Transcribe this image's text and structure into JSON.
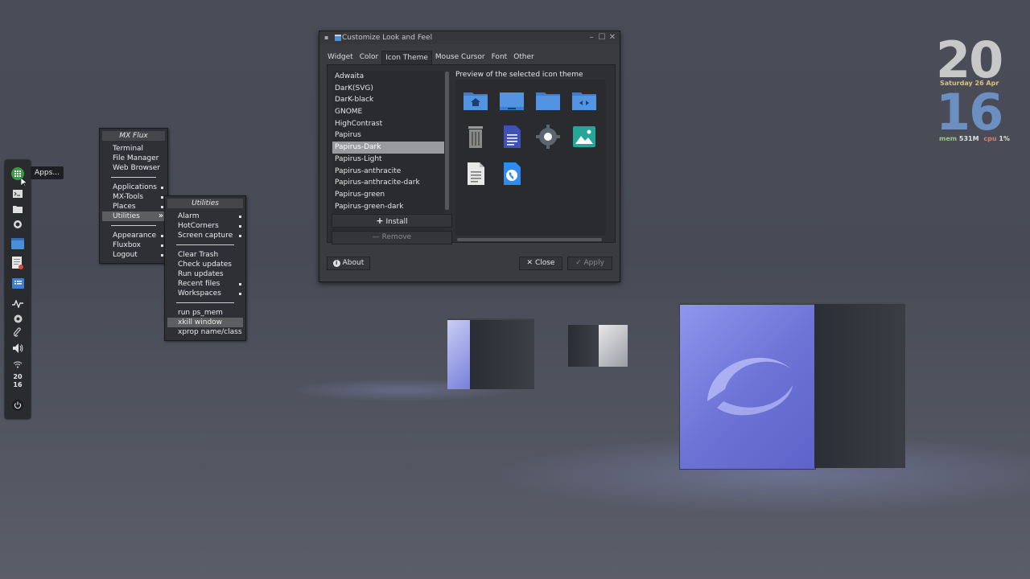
{
  "dock": {
    "tooltip": "Apps...",
    "clock_hour": "20",
    "clock_min": "16"
  },
  "mx_menu": {
    "title": "MX Flux",
    "items": [
      "Terminal",
      "File Manager",
      "Web Browser"
    ],
    "items2": [
      "Applications",
      "MX-Tools",
      "Places",
      "Utilities"
    ],
    "items3": [
      "Appearance",
      "Fluxbox",
      "Logout"
    ]
  },
  "utilities_menu": {
    "title": "Utilities",
    "items": [
      "Alarm",
      "HotCorners",
      "Screen capture"
    ],
    "items2": [
      "Clear Trash",
      "Check updates",
      "Run updates",
      "Recent files",
      "Workspaces"
    ],
    "items3": [
      "run ps_mem",
      "xkill window",
      "xprop name/class"
    ]
  },
  "dialog": {
    "title": "Customize Look and Feel",
    "tabs": [
      "Widget",
      "Color",
      "Icon Theme",
      "Mouse Cursor",
      "Font",
      "Other"
    ],
    "themes": [
      "Adwaita",
      "DarK(SVG)",
      "DarK-black",
      "GNOME",
      "HighContrast",
      "Papirus",
      "Papirus-Dark",
      "Papirus-Light",
      "Papirus-anthracite",
      "Papirus-anthracite-dark",
      "Papirus-green",
      "Papirus-green-dark"
    ],
    "selected_theme": "Papirus-Dark",
    "preview_label": "Preview of the selected icon theme",
    "install": "Install",
    "remove": "Remove",
    "about": "About",
    "close": "Close",
    "apply": "Apply"
  },
  "clock": {
    "hour": "20",
    "date": "Saturday 26 Apr",
    "minute": "16",
    "mem_label": "mem",
    "mem_value": "531M",
    "cpu_label": "cpu",
    "cpu_value": "1%"
  },
  "colors": {
    "accent": "#6a8fc0",
    "folder_blue": "#5294e2",
    "clock_date": "#dcc37a"
  }
}
